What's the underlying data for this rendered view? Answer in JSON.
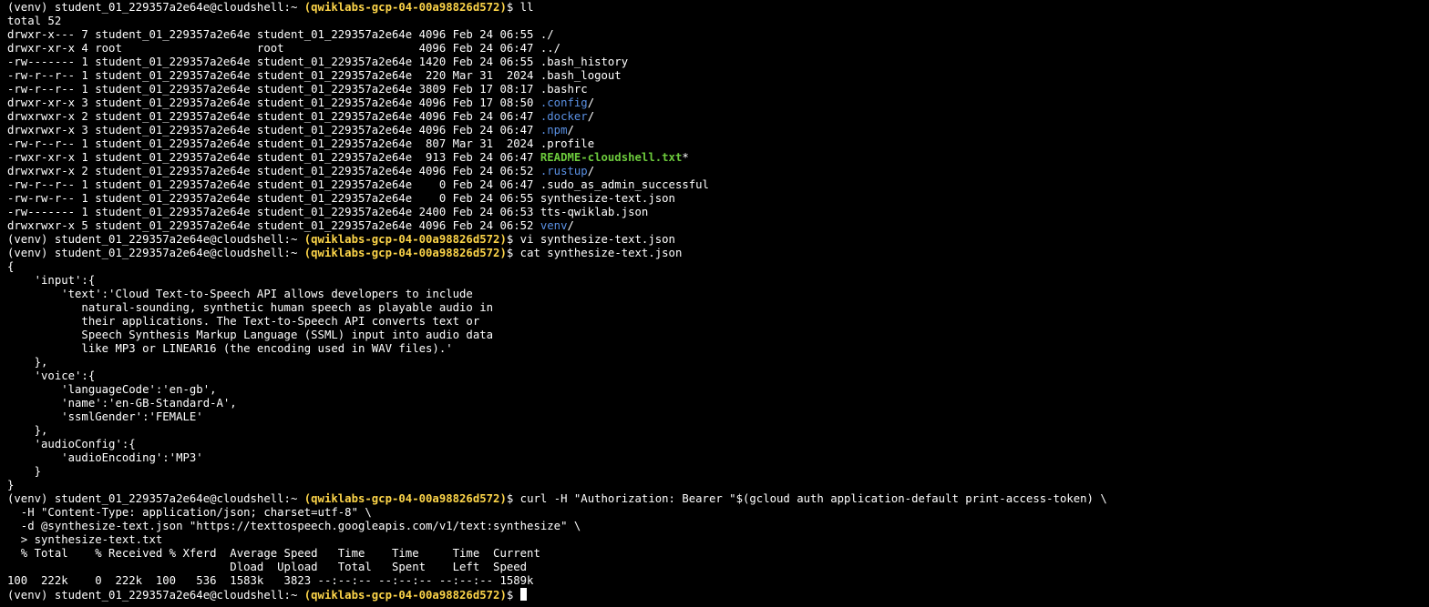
{
  "prompt": {
    "prefix": "(venv) student_01_229357a2e64e@cloudshell:~ ",
    "project": "(qwiklabs-gcp-04-00a98826d572)",
    "suffix": "$ "
  },
  "commands": {
    "ll": "ll",
    "vi": "vi synthesize-text.json",
    "cat": "cat synthesize-text.json",
    "curl_1": "curl -H \"Authorization: Bearer \"$(gcloud auth application-default print-access-token) \\",
    "curl_2": "  -H \"Content-Type: application/json; charset=utf-8\" \\",
    "curl_3": "  -d @synthesize-text.json \"https://texttospeech.googleapis.com/v1/text:synthesize\" \\",
    "curl_4": "  > synthesize-text.txt"
  },
  "ls_total": "total 52",
  "ls_rows": [
    {
      "meta": "drwxr-x--- 7 student_01_229357a2e64e student_01_229357a2e64e 4096 Feb 24 06:55 ",
      "name": "./",
      "type": "plain"
    },
    {
      "meta": "drwxr-xr-x 4 root                    root                    4096 Feb 24 06:47 ",
      "name": "../",
      "type": "plain"
    },
    {
      "meta": "-rw------- 1 student_01_229357a2e64e student_01_229357a2e64e 1420 Feb 24 06:55 ",
      "name": ".bash_history",
      "type": "plain"
    },
    {
      "meta": "-rw-r--r-- 1 student_01_229357a2e64e student_01_229357a2e64e  220 Mar 31  2024 ",
      "name": ".bash_logout",
      "type": "plain"
    },
    {
      "meta": "-rw-r--r-- 1 student_01_229357a2e64e student_01_229357a2e64e 3809 Feb 17 08:17 ",
      "name": ".bashrc",
      "type": "plain"
    },
    {
      "meta": "drwxr-xr-x 3 student_01_229357a2e64e student_01_229357a2e64e 4096 Feb 17 08:50 ",
      "name": ".config",
      "type": "dir"
    },
    {
      "meta": "drwxrwxr-x 2 student_01_229357a2e64e student_01_229357a2e64e 4096 Feb 24 06:47 ",
      "name": ".docker",
      "type": "dir"
    },
    {
      "meta": "drwxrwxr-x 3 student_01_229357a2e64e student_01_229357a2e64e 4096 Feb 24 06:47 ",
      "name": ".npm",
      "type": "dir"
    },
    {
      "meta": "-rw-r--r-- 1 student_01_229357a2e64e student_01_229357a2e64e  807 Mar 31  2024 ",
      "name": ".profile",
      "type": "plain"
    },
    {
      "meta": "-rwxr-xr-x 1 student_01_229357a2e64e student_01_229357a2e64e  913 Feb 24 06:47 ",
      "name": "README-cloudshell.txt",
      "type": "exec"
    },
    {
      "meta": "drwxrwxr-x 2 student_01_229357a2e64e student_01_229357a2e64e 4096 Feb 24 06:52 ",
      "name": ".rustup",
      "type": "dir"
    },
    {
      "meta": "-rw-r--r-- 1 student_01_229357a2e64e student_01_229357a2e64e    0 Feb 24 06:47 ",
      "name": ".sudo_as_admin_successful",
      "type": "plain"
    },
    {
      "meta": "-rw-rw-r-- 1 student_01_229357a2e64e student_01_229357a2e64e    0 Feb 24 06:55 ",
      "name": "synthesize-text.json",
      "type": "plain"
    },
    {
      "meta": "-rw------- 1 student_01_229357a2e64e student_01_229357a2e64e 2400 Feb 24 06:53 ",
      "name": "tts-qwiklab.json",
      "type": "plain"
    },
    {
      "meta": "drwxrwxr-x 5 student_01_229357a2e64e student_01_229357a2e64e 4096 Feb 24 06:52 ",
      "name": "venv",
      "type": "dir"
    }
  ],
  "json_lines": [
    "{",
    "    'input':{",
    "        'text':'Cloud Text-to-Speech API allows developers to include",
    "           natural-sounding, synthetic human speech as playable audio in",
    "           their applications. The Text-to-Speech API converts text or",
    "           Speech Synthesis Markup Language (SSML) input into audio data",
    "           like MP3 or LINEAR16 (the encoding used in WAV files).'",
    "    },",
    "    'voice':{",
    "        'languageCode':'en-gb',",
    "        'name':'en-GB-Standard-A',",
    "        'ssmlGender':'FEMALE'",
    "    },",
    "    'audioConfig':{",
    "        'audioEncoding':'MP3'",
    "    }",
    "}"
  ],
  "curl_progress": [
    "  % Total    % Received % Xferd  Average Speed   Time    Time     Time  Current",
    "                                 Dload  Upload   Total   Spent    Left  Speed",
    "100  222k    0  222k  100   536  1583k   3823 --:--:-- --:--:-- --:--:-- 1589k"
  ]
}
